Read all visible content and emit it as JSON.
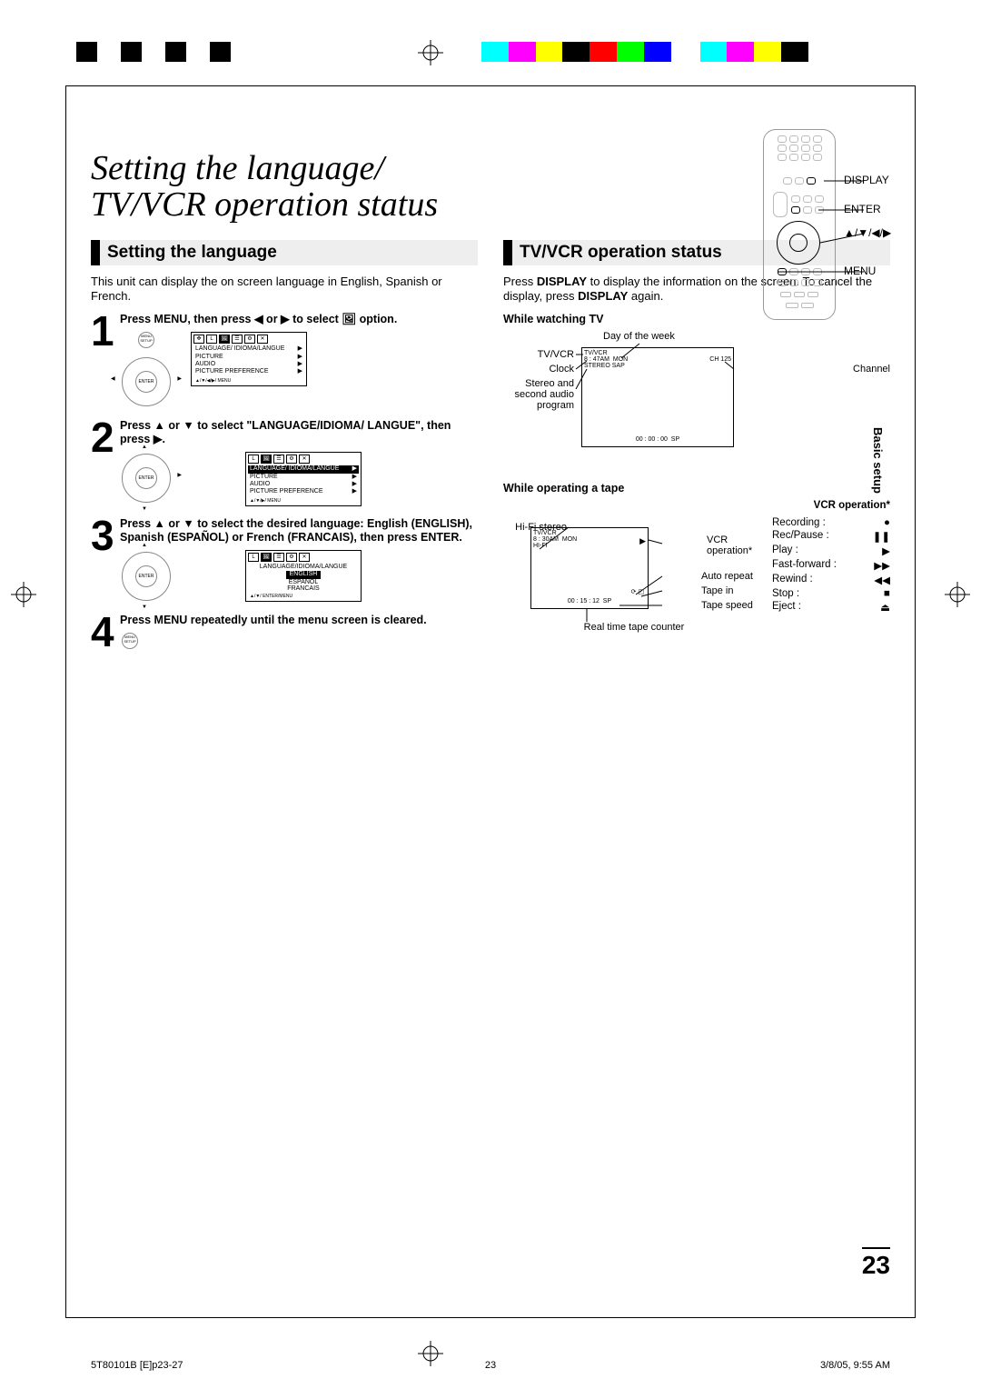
{
  "page_title_l1": "Setting the language/",
  "page_title_l2": "TV/VCR operation status",
  "side_tab": "Basic setup",
  "page_number": "23",
  "remote_labels": {
    "display": "DISPLAY",
    "enter": "ENTER",
    "arrows": "▲/▼/◀/▶",
    "menu": "MENU"
  },
  "left": {
    "heading": "Setting the language",
    "intro": "This unit can display the on screen language in English, Spanish or French.",
    "steps": [
      {
        "num": "1",
        "instr": "Press MENU, then press ◀ or ▶ to select 🖼 option.",
        "dpad_center": "ENTER",
        "menu_btn": "MENU SETUP",
        "menu_items": [
          "LANGUAGE/ IDIOMA/LANGUE",
          "PICTURE",
          "AUDIO",
          "PICTURE PREFERENCE"
        ],
        "menu_foot": "▲/▼/◀/▶/ MENU"
      },
      {
        "num": "2",
        "instr": "Press ▲ or ▼ to select \"LANGUAGE/IDIOMA/ LANGUE\", then press ▶.",
        "dpad_center": "ENTER",
        "menu_items": [
          "LANGUAGE/ IDIOMA/LANGUE",
          "PICTURE",
          "AUDIO",
          "PICTURE PREFERENCE"
        ],
        "menu_sel": 0,
        "menu_foot": "▲/▼/▶/ MENU"
      },
      {
        "num": "3",
        "instr": "Press ▲ or ▼ to select the desired language: English (ENGLISH), Spanish (ESPAÑOL) or French (FRANCAIS), then press ENTER.",
        "dpad_center": "ENTER",
        "menu_title": "LANGUAGE/IDIOMA/LANGUE",
        "menu_items": [
          "ENGLISH",
          "ESPAÑOL",
          "FRANCAIS"
        ],
        "menu_sel": 0,
        "menu_foot": "▲/▼/ ENTER/MENU"
      },
      {
        "num": "4",
        "instr": "Press MENU repeatedly until the menu screen is cleared.",
        "menu_btn": "MENU SETUP"
      }
    ]
  },
  "right": {
    "heading": "TV/VCR operation status",
    "intro_l1": "Press DISPLAY to display the information on the screen.",
    "intro_l2": "To cancel the display, press DISPLAY again.",
    "tv": {
      "head": "While watching TV",
      "labels": {
        "tvvcr": "TV/VCR",
        "clock": "Clock",
        "stereo": "Stereo and second audio program",
        "day": "Day of the week",
        "channel": "Channel"
      },
      "osd": {
        "line1": "TV/VCR",
        "line2_a": "8 : 47AM",
        "line2_b": "MON",
        "line2_c": "CH 125",
        "line3": "STEREO SAP",
        "line4_a": "00 : 00 : 00",
        "line4_b": "SP"
      }
    },
    "tape": {
      "head": "While operating a tape",
      "vcr_op_head": "VCR operation*",
      "labels": {
        "hifi": "Hi-Fi stereo",
        "vcr": "VCR operation*",
        "auto": "Auto repeat",
        "tapein": "Tape in",
        "speed": "Tape speed",
        "counter": "Real time tape counter"
      },
      "osd": {
        "line1": "TV/VCR",
        "line2_a": "8 : 30AM",
        "line2_b": "MON",
        "line3": "HI-FI",
        "line4_a": "00 : 15 : 12",
        "line4_b": "SP"
      },
      "ops": [
        {
          "name": "Recording",
          "sym": "●"
        },
        {
          "name": "Rec/Pause",
          "sym": "❚❚"
        },
        {
          "name": "Play",
          "sym": "▶"
        },
        {
          "name": "Fast-forward",
          "sym": "▶▶"
        },
        {
          "name": "Rewind",
          "sym": "◀◀"
        },
        {
          "name": "Stop",
          "sym": "■"
        },
        {
          "name": "Eject",
          "sym": "⏏"
        }
      ]
    }
  },
  "footer": {
    "left": "5T80101B [E]p23-27",
    "mid": "23",
    "right": "3/8/05, 9:55 AM"
  }
}
